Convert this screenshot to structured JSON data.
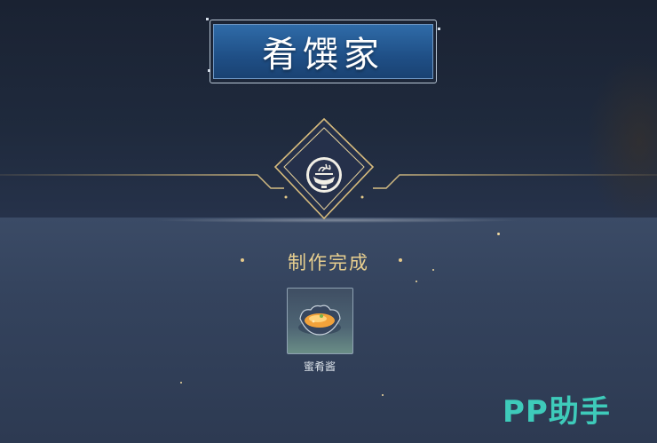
{
  "header": {
    "title": "肴馔家"
  },
  "result": {
    "status_label": "制作完成",
    "item": {
      "name": "蜜肴酱",
      "icon": "honey-sauce-bowl-icon"
    }
  },
  "emblem": {
    "icon": "cooking-bowl-emblem-icon"
  },
  "watermark": {
    "text": "PP助手"
  },
  "colors": {
    "accent_gold": "#e8cf8f",
    "title_blue": "#2f6ba8",
    "watermark_teal": "#3fd3c0",
    "panel": "#34435d"
  }
}
